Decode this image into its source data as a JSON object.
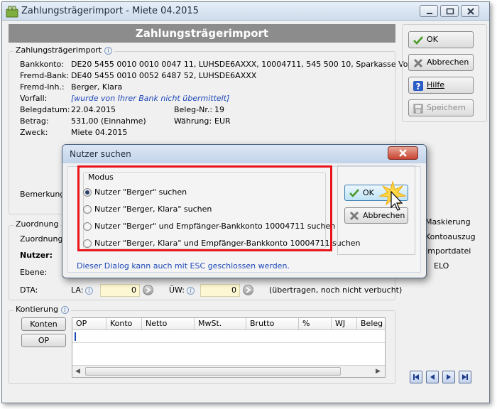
{
  "window": {
    "title": "Zahlungsträgerimport - Miete 04.2015",
    "header": "Zahlungsträgerimport"
  },
  "import_group": {
    "title": "Zahlungsträgerimport",
    "bankkonto_label": "Bankkonto:",
    "bankkonto_value": "DE20 5455 0010 0010 0047 11,  LUHSDE6AXXX,  10004711,  545 500 10,  Sparkasse Vord",
    "fremdbank_label": "Fremd-Bank:",
    "fremdbank_value": "DE40 5455 0010 0052 6487 52,  LUHSDE6AXXX",
    "fremdinh_label": "Fremd-Inh.:",
    "fremdinh_value": "Berger, Klara",
    "vorfall_label": "Vorfall:",
    "vorfall_value": "[wurde von Ihrer Bank nicht übermittelt]",
    "belegdatum_label": "Belegdatum:",
    "belegdatum_value": "22.04.2015",
    "belegnr_label": "Beleg-Nr.:",
    "belegnr_value": "19",
    "betrag_label": "Betrag:",
    "betrag_value": "531,00 (Einnahme)",
    "waehrung_label": "Währung:",
    "waehrung_value": "EUR",
    "zweck_label": "Zweck:",
    "zweck_value": "Miete 04.2015",
    "bemerkung_label": "Bemerkung:"
  },
  "zuordnung": {
    "title": "Zuordnung",
    "zuordnung_label": "Zuordnung:",
    "nutzer_label": "Nutzer:",
    "ebene_label": "Ebene:",
    "dta_label": "DTA:",
    "la_label": "LA:",
    "la_value": "0",
    "uew_label": "ÜW:",
    "uew_value": "0",
    "dta_note": "(übertragen, noch nicht verbucht)"
  },
  "right_options": {
    "maskierung": "Maskierung",
    "kontoauszug": "Kontoauszug",
    "importdatei": "Importdatei",
    "elo": "ELO"
  },
  "kontierung": {
    "title": "Kontierung",
    "konten_button": "Konten",
    "op_button": "OP",
    "columns": [
      "OP",
      "Konto",
      "Netto",
      "MwSt.",
      "Brutto",
      "%",
      "WJ",
      "Beleg"
    ]
  },
  "side_buttons": {
    "ok": "OK",
    "abbrechen": "Abbrechen",
    "hilfe": "Hilfe",
    "speichern": "Speichern"
  },
  "dialog": {
    "title": "Nutzer suchen",
    "group_title": "Modus",
    "options": [
      "Nutzer \"Berger\" suchen",
      "Nutzer \"Berger, Klara\" suchen",
      "Nutzer \"Berger\" und Empfänger-Bankkonto 10004711 suchen",
      "Nutzer \"Berger, Klara\" und Empfänger-Bankkonto 10004711 suchen"
    ],
    "selected_index": 0,
    "ok": "OK",
    "abbrechen": "Abbrechen",
    "hint": "Dieser Dialog kann auch mit ESC geschlossen werden."
  },
  "colors": {
    "header_bar": "#8c8c8c",
    "highlight_frame": "#e8141a",
    "input_field": "#fdf7d3",
    "link_text": "#1e48b8"
  }
}
